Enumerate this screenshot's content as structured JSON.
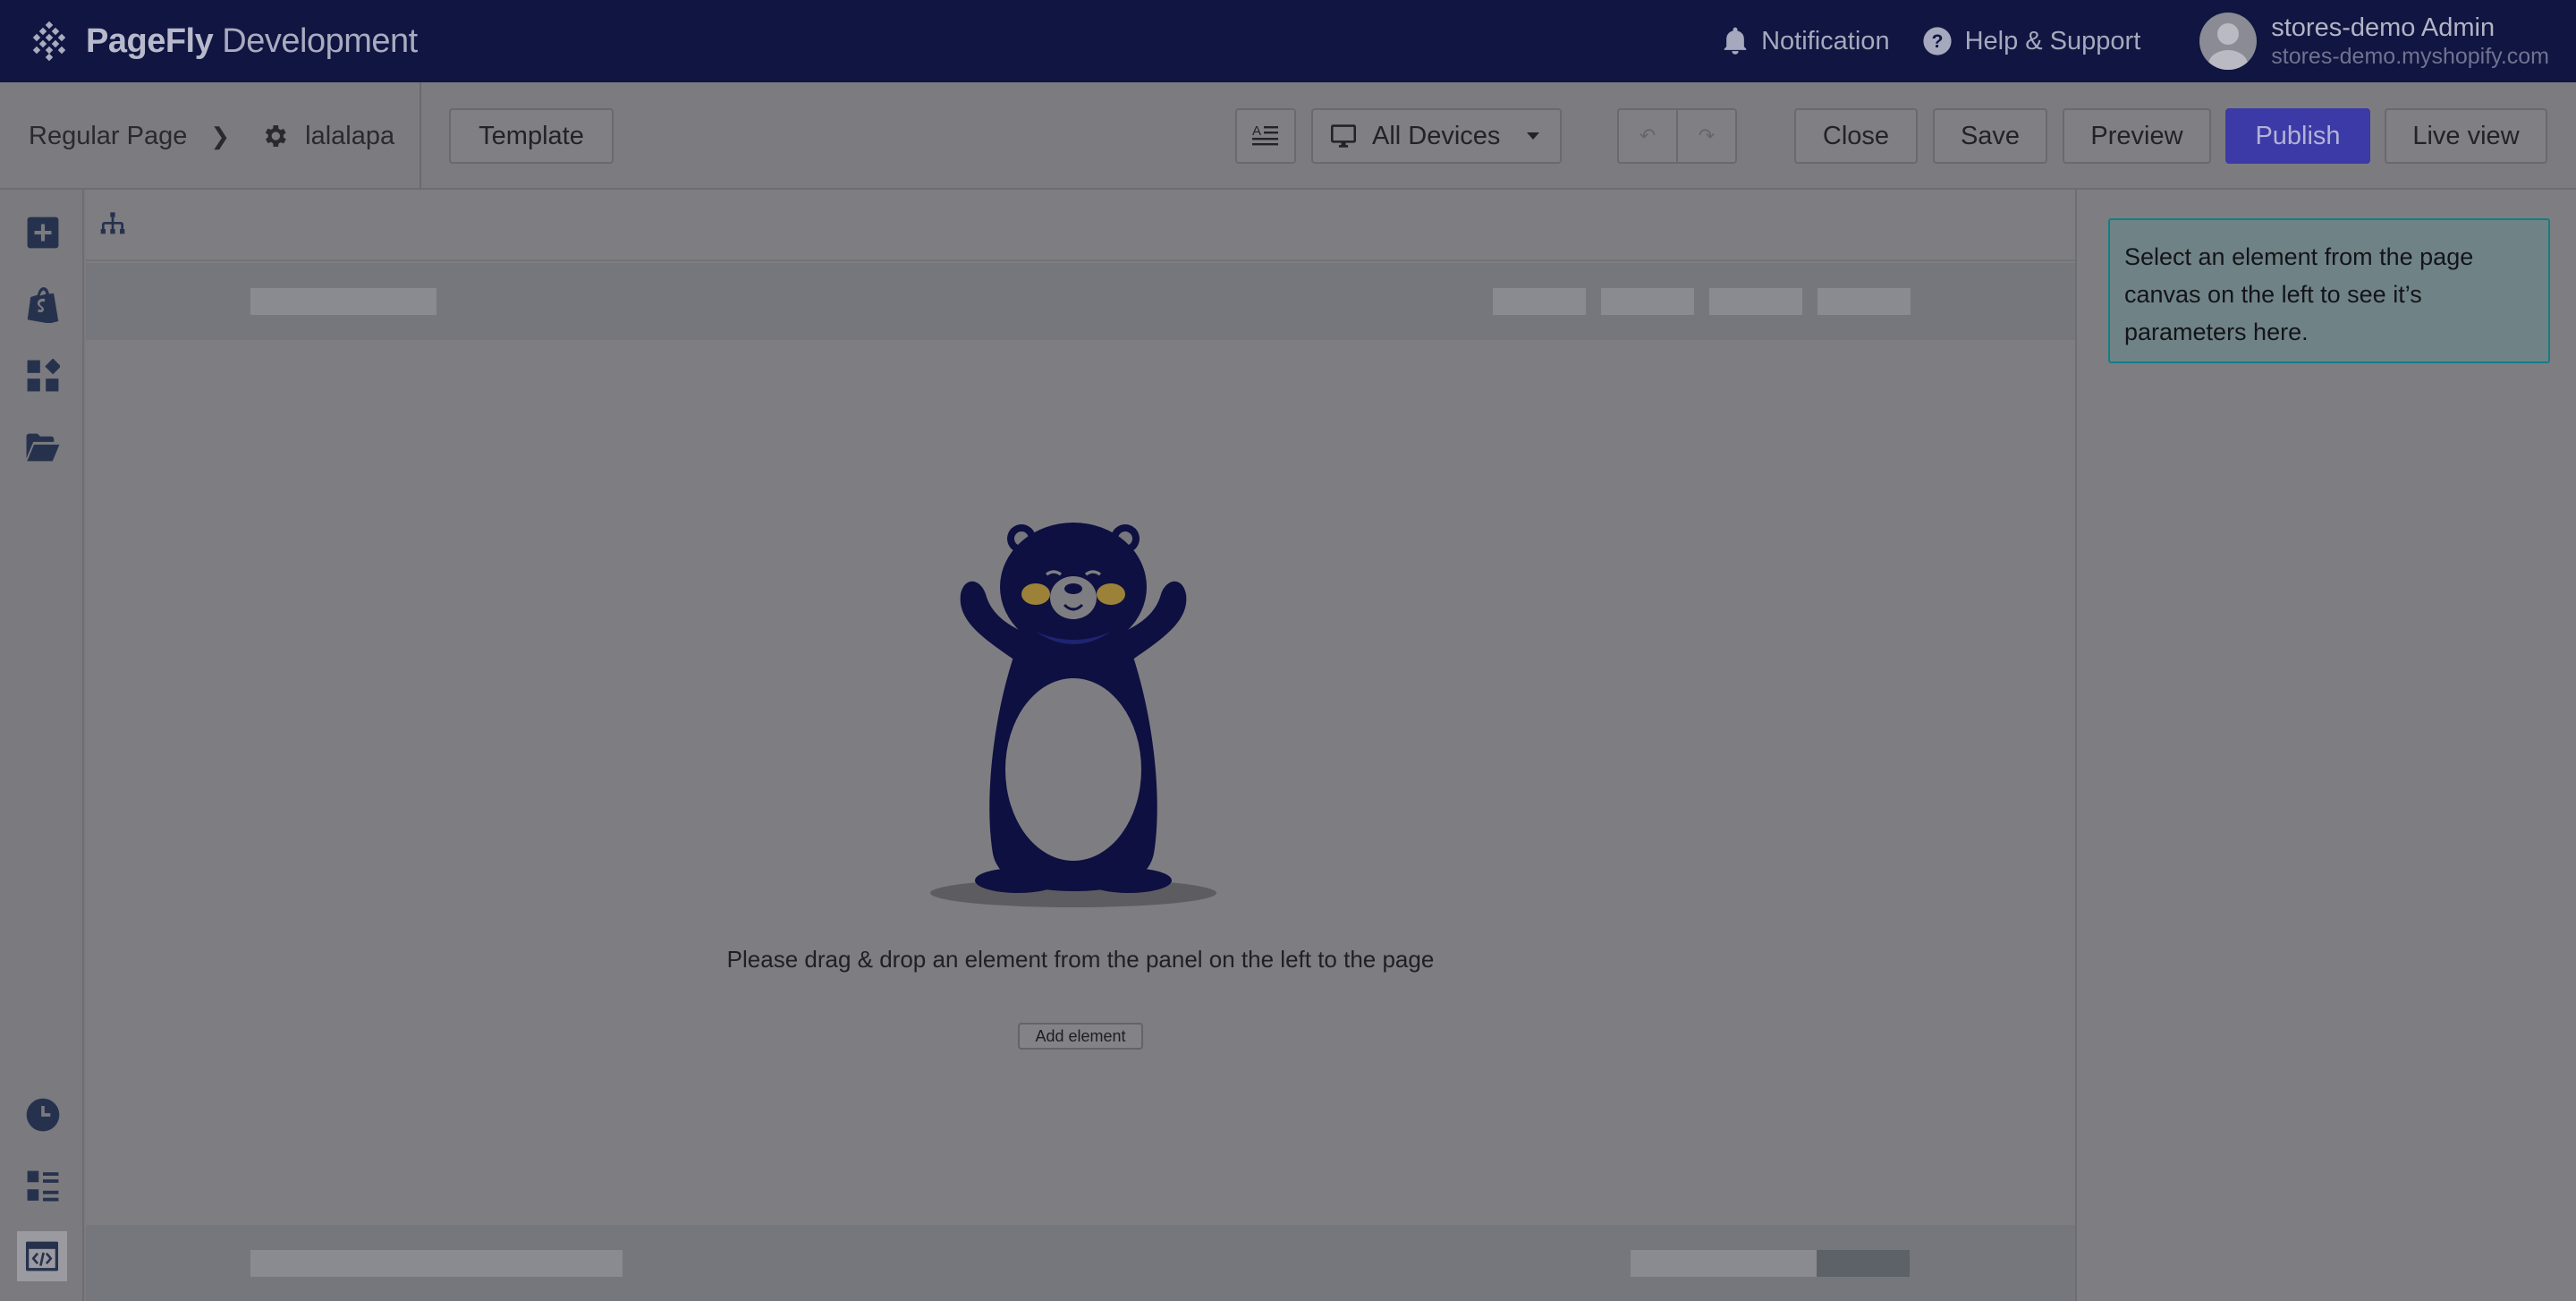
{
  "app": {
    "brand_bold": "PageFly",
    "brand_rest": " Development"
  },
  "topbar": {
    "notification": "Notification",
    "help": "Help & Support",
    "user_name": "stores-demo Admin",
    "user_store": "stores-demo.myshopify.com"
  },
  "toolbar": {
    "page_type": "Regular Page",
    "page_name": "lalalapa",
    "template": "Template",
    "device": "All Devices",
    "close": "Close",
    "save": "Save",
    "preview": "Preview",
    "publish": "Publish",
    "live_view": "Live view"
  },
  "canvas": {
    "empty_message": "Please drag & drop an element from the panel on the left to the page",
    "add_element": "Add element"
  },
  "inspector": {
    "hint": "Select an element from the page canvas on the left to see it’s parameters here."
  },
  "colors": {
    "topbar_bg": "#101541",
    "publish_bg": "#3c3aa6",
    "hint_border": "#127f85",
    "bear": "#0e1041"
  },
  "icons": [
    "pagefly-logo-icon",
    "bell-icon",
    "help-circle-icon",
    "chevron-right-icon",
    "gear-icon",
    "text-style-icon",
    "desktop-icon",
    "caret-down-icon",
    "undo-icon",
    "redo-icon",
    "sitemap-icon",
    "plus-square-icon",
    "shopify-bag-icon",
    "widgets-icon",
    "folder-open-icon",
    "history-icon",
    "list-icon",
    "code-icon"
  ]
}
